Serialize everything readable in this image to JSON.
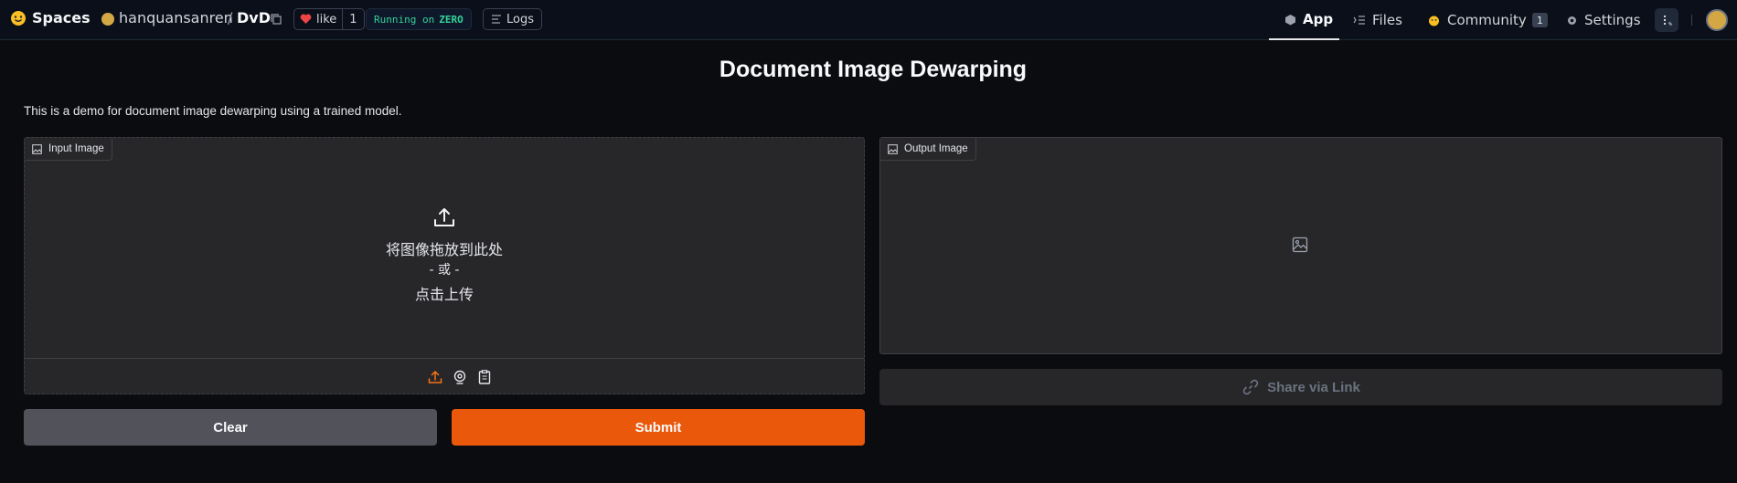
{
  "header": {
    "brand": "Spaces",
    "owner": "hanquansanren",
    "separator": "/",
    "repo": "DvD",
    "like_label": "like",
    "like_count": "1",
    "running_text": "Running on",
    "running_hw": "ZERO",
    "logs_label": "Logs",
    "nav": {
      "app": "App",
      "files": "Files",
      "community": "Community",
      "community_count": "1",
      "settings": "Settings"
    }
  },
  "main": {
    "title": "Document Image Dewarping",
    "description": "This is a demo for document image dewarping using a trained model.",
    "input_panel": {
      "label": "Input Image",
      "drop_line1": "将图像拖放到此处",
      "drop_line2": "- 或 -",
      "drop_line3": "点击上传"
    },
    "output_panel": {
      "label": "Output Image"
    },
    "share_label": "Share via Link",
    "clear_label": "Clear",
    "submit_label": "Submit"
  },
  "colors": {
    "accent": "#ea580c",
    "background": "#0b0c0f",
    "panel": "#27272a",
    "running": "#34d399",
    "like_heart": "#ef4444"
  },
  "icons": [
    "hf-logo-icon",
    "copy-icon",
    "heart-icon",
    "logs-icon",
    "cube-icon",
    "files-icon",
    "community-icon",
    "gear-icon",
    "more-icon",
    "image-icon",
    "upload-icon",
    "webcam-icon",
    "clipboard-icon",
    "link-icon"
  ]
}
